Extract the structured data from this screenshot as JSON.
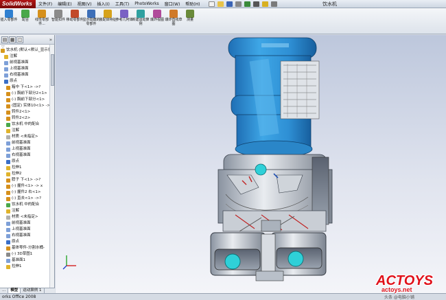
{
  "app": {
    "logo": "SolidWorks",
    "document_title": "饮水机",
    "menu": [
      "文件(F)",
      "编辑(E)",
      "视图(V)",
      "插入(I)",
      "工具(T)",
      "PhotoWorks",
      "窗口(W)",
      "帮助(H)"
    ]
  },
  "toolbar": {
    "items": [
      {
        "label": "插入零部件",
        "icon": "insert-component-icon",
        "color": "#2f7fd0"
      },
      {
        "label": "配合",
        "icon": "mate-icon",
        "color": "#4aa84a"
      },
      {
        "label": "线性零部件...",
        "icon": "linear-pattern-icon",
        "color": "#d6901c"
      },
      {
        "label": "智能扣件",
        "icon": "smart-fastener-icon",
        "color": "#8a8a8a"
      },
      {
        "label": "移动零部件",
        "icon": "move-component-icon",
        "color": "#c24a2a"
      },
      {
        "label": "显示隐藏的零部件",
        "icon": "show-hidden-icon",
        "color": "#3d6fb8"
      },
      {
        "label": "装配体特征",
        "icon": "assembly-feature-icon",
        "color": "#d6a21c"
      },
      {
        "label": "参考几何体",
        "icon": "reference-geometry-icon",
        "color": "#7a62c4"
      },
      {
        "label": "新建运动算例",
        "icon": "motion-study-icon",
        "color": "#2fa0a0"
      },
      {
        "label": "爆炸视图",
        "icon": "exploded-view-icon",
        "color": "#b04a9a"
      },
      {
        "label": "爆炸直线草图",
        "icon": "explode-line-icon",
        "color": "#d07a2a"
      },
      {
        "label": "测量",
        "icon": "measure-icon",
        "color": "#6a8a3a"
      }
    ]
  },
  "tree": {
    "items": [
      {
        "text": "饮水机 (默认<默认_显示状",
        "color": "#d69a1c"
      },
      {
        "text": "注解",
        "color": "#e0b32c"
      },
      {
        "text": "前视基准面",
        "color": "#7ea0d8"
      },
      {
        "text": "上视基准面",
        "color": "#7ea0d8"
      },
      {
        "text": "右视基准面",
        "color": "#7ea0d8"
      },
      {
        "text": "原点",
        "color": "#3a6fc8"
      },
      {
        "text": "箱中 下<1> ->?",
        "color": "#d6901c"
      },
      {
        "text": "(-) 胸前下部分2<1>",
        "color": "#d6901c"
      },
      {
        "text": "(-) 胸前下部分<1>",
        "color": "#d6901c"
      },
      {
        "text": "(固定) 实体10<1> ->?",
        "color": "#d6901c"
      },
      {
        "text": "转件2<1>",
        "color": "#d6901c"
      },
      {
        "text": "转件2<2>",
        "color": "#d6901c"
      },
      {
        "text": "饮水机 中的配合",
        "color": "#4aa84a"
      },
      {
        "text": "注解",
        "color": "#e0b32c"
      },
      {
        "text": "材质 <未指定>",
        "color": "#b0b0b0"
      },
      {
        "text": "前视基准面",
        "color": "#7ea0d8"
      },
      {
        "text": "上视基准面",
        "color": "#7ea0d8"
      },
      {
        "text": "右视基准面",
        "color": "#7ea0d8"
      },
      {
        "text": "原点",
        "color": "#3a6fc8"
      },
      {
        "text": "拉伸1",
        "color": "#e0b32c"
      },
      {
        "text": "拉伸2",
        "color": "#e0b32c"
      },
      {
        "text": "脖子 下<1> ->?",
        "color": "#d6901c"
      },
      {
        "text": "(-) 握件<1> -> x",
        "color": "#d6901c"
      },
      {
        "text": "(-) 握件2 右<1>",
        "color": "#d6901c"
      },
      {
        "text": "(-) 直去<1> ->?",
        "color": "#d6901c"
      },
      {
        "text": "饮水机 中的配合",
        "color": "#4aa84a"
      },
      {
        "text": "注解",
        "color": "#e0b32c"
      },
      {
        "text": "材质 <未指定>",
        "color": "#b0b0b0"
      },
      {
        "text": "前视基准面",
        "color": "#7ea0d8"
      },
      {
        "text": "上视基准面",
        "color": "#7ea0d8"
      },
      {
        "text": "右视基准面",
        "color": "#7ea0d8"
      },
      {
        "text": "原点",
        "color": "#3a6fc8"
      },
      {
        "text": "基体零件-分割水桶-",
        "color": "#d6901c"
      },
      {
        "text": "(-) 3D草图1",
        "color": "#8a8a8a"
      },
      {
        "text": "基准面1",
        "color": "#7ea0d8"
      },
      {
        "text": "拉伸1",
        "color": "#e0b32c"
      }
    ]
  },
  "bottom_tabs": [
    "...",
    "模型",
    "运动算例 1"
  ],
  "status": {
    "text": "orks Office 2008"
  },
  "watermark": {
    "logo": "ACTOYS",
    "url": "actoys.net",
    "caption": "头条 @电脑小铺"
  }
}
